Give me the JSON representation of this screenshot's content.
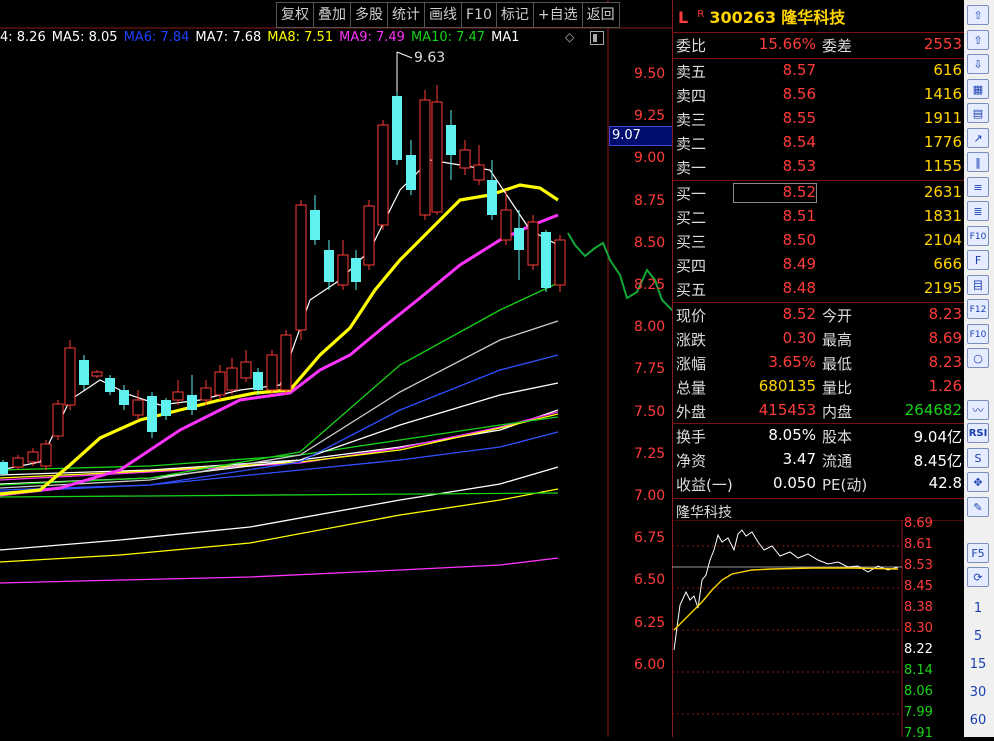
{
  "toolbar": {
    "items": [
      "复权",
      "叠加",
      "多股",
      "统计",
      "画线",
      "F10",
      "标记",
      "+自选",
      "返回"
    ]
  },
  "ma_bar": [
    {
      "label": "4: 8.26",
      "color": "#ffffff"
    },
    {
      "label": "MA5: 8.05",
      "color": "#ffffff"
    },
    {
      "label": "MA6: 7.84",
      "color": "#2040ff"
    },
    {
      "label": "MA7: 7.68",
      "color": "#ffffff"
    },
    {
      "label": "MA8: 7.51",
      "color": "#ffff00"
    },
    {
      "label": "MA9: 7.49",
      "color": "#ff33ff"
    },
    {
      "label": "MA10: 7.47",
      "color": "#19d319"
    },
    {
      "label": "MA1",
      "color": "#ffffff"
    }
  ],
  "chart": {
    "high_marker": "9.63",
    "current_price_box": "9.07",
    "y_ticks": [
      "9.50",
      "9.25",
      "9.00",
      "8.75",
      "8.50",
      "8.25",
      "8.00",
      "7.75",
      "7.50",
      "7.25",
      "7.00",
      "6.75",
      "6.50",
      "6.25",
      "6.00"
    ]
  },
  "stock": {
    "flag_l": "L",
    "flag_r": "R",
    "code": "300263",
    "name": "隆华科技"
  },
  "order_book": {
    "weibi_label": "委比",
    "weibi": "15.66%",
    "weicha_label": "委差",
    "weicha": "2553",
    "asks": [
      {
        "label": "卖五",
        "price": "8.57",
        "vol": "616"
      },
      {
        "label": "卖四",
        "price": "8.56",
        "vol": "1416"
      },
      {
        "label": "卖三",
        "price": "8.55",
        "vol": "1911"
      },
      {
        "label": "卖二",
        "price": "8.54",
        "vol": "1776"
      },
      {
        "label": "卖一",
        "price": "8.53",
        "vol": "1155"
      }
    ],
    "bids": [
      {
        "label": "买一",
        "price": "8.52",
        "vol": "2631"
      },
      {
        "label": "买二",
        "price": "8.51",
        "vol": "1831"
      },
      {
        "label": "买三",
        "price": "8.50",
        "vol": "2104"
      },
      {
        "label": "买四",
        "price": "8.49",
        "vol": "666"
      },
      {
        "label": "买五",
        "price": "8.48",
        "vol": "2195"
      }
    ]
  },
  "quote": [
    {
      "l1": "现价",
      "v1": "8.52",
      "l2": "今开",
      "v2": "8.23"
    },
    {
      "l1": "涨跌",
      "v1": "0.30",
      "l2": "最高",
      "v2": "8.69"
    },
    {
      "l1": "涨幅",
      "v1": "3.65%",
      "l2": "最低",
      "v2": "8.23"
    },
    {
      "l1": "总量",
      "v1": "680135",
      "l2": "量比",
      "v2": "1.26"
    },
    {
      "l1": "外盘",
      "v1": "415453",
      "l2": "内盘",
      "v2": "264682"
    }
  ],
  "fundamentals": [
    {
      "l1": "换手",
      "v1": "8.05%",
      "l2": "股本",
      "v2": "9.04亿"
    },
    {
      "l1": "净资",
      "v1": "3.47",
      "l2": "流通",
      "v2": "8.45亿"
    },
    {
      "l1": "收益(一)",
      "v1": "0.050",
      "l2": "PE(动)",
      "v2": "42.8"
    }
  ],
  "mini_chart": {
    "title": "隆华科技",
    "ticks": [
      "8.69",
      "8.61",
      "8.53",
      "8.45",
      "8.38",
      "8.30",
      "8.22",
      "8.14",
      "8.06",
      "7.99",
      "7.91"
    ]
  },
  "side_icons": {
    "numbers": [
      "1",
      "5",
      "15",
      "30",
      "60"
    ],
    "f5": "F5",
    "rsi": "RSI"
  }
}
